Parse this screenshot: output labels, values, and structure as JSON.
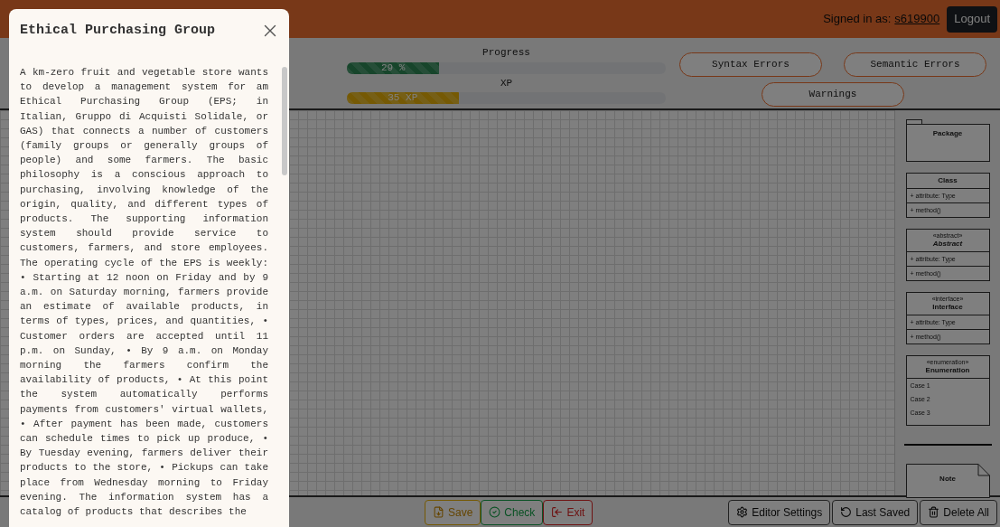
{
  "header": {
    "signed_in_label": "Signed in as:",
    "username": "s619900",
    "logout": "Logout"
  },
  "progress": {
    "title": "Progress",
    "level": 0.29,
    "reading": "29 %"
  },
  "xp": {
    "title": "XP",
    "level": 0.35,
    "reading": "35 XP"
  },
  "issue_buttons": [
    "Syntax Errors",
    "Semantic Errors",
    "Warnings"
  ],
  "palette": [
    {
      "kind": "package",
      "name": "Package"
    },
    {
      "kind": "class",
      "name": "Class",
      "rows": [
        "+ attribute: Type",
        "+ method()"
      ]
    },
    {
      "kind": "class",
      "stereotype": "«abstract»",
      "name": "Abstract",
      "italic": true,
      "rows": [
        "+ attribute: Type",
        "+ method()"
      ]
    },
    {
      "kind": "class",
      "stereotype": "«interface»",
      "name": "Interface",
      "rows": [
        "+ attribute: Type",
        "+ method()"
      ]
    },
    {
      "kind": "enum",
      "stereotype": "«enumeration»",
      "name": "Enumeration",
      "rows": [
        "Case 1",
        "Case 2",
        "Case 3"
      ]
    },
    {
      "kind": "divider"
    },
    {
      "kind": "note",
      "name": "Note"
    }
  ],
  "left_buttons": [
    {
      "kind": "save",
      "label": "Save"
    },
    {
      "kind": "check",
      "label": "Check"
    },
    {
      "kind": "exit",
      "label": "Exit"
    }
  ],
  "right_buttons": [
    {
      "kind": "settings",
      "label": "Editor Settings"
    },
    {
      "kind": "undo",
      "label": "Last Saved"
    },
    {
      "kind": "delete",
      "label": "Delete All"
    }
  ],
  "dialog": {
    "title": "Ethical Purchasing Group",
    "text": "A km-zero fruit and vegetable store wants to develop a management system for am Ethical Purchasing Group (EPS; in Italian, Gruppo di Acquisti Solidale, or GAS) that connects a number of customers (family groups or generally groups of people) and some farmers. The basic philosophy is a conscious approach to purchasing, involving knowledge of the origin, quality, and different types of products. The supporting information system should provide service to customers, farmers, and store employees. The operating cycle of the EPS is weekly: • Starting at 12 noon on Friday and by 9 a.m. on Saturday morning, farmers provide an estimate of available products, in terms of types, prices, and quantities, • Customer orders are accepted until 11 p.m. on Sunday, • By 9 a.m. on Monday morning the farmers confirm the availability of products, • At this point the system automatically performs payments from customers' virtual wallets, • After payment has been made, customers can schedule times to pick up produce, • By Tuesday evening, farmers deliver their products to the store, • Pickups can take place from Wednesday morning to Friday evening. The information system has a catalog of products that describes the"
  }
}
